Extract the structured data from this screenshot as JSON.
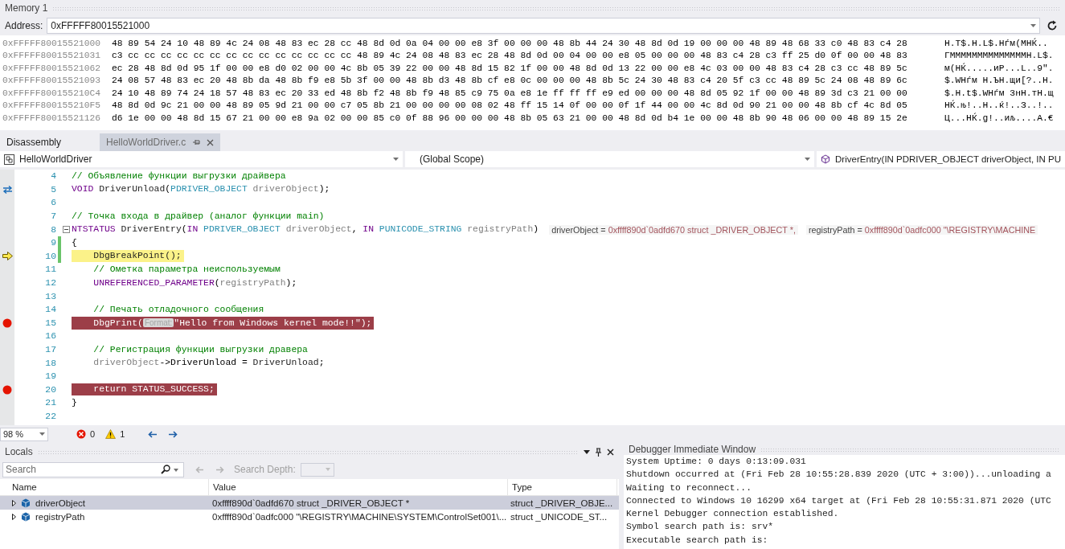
{
  "memory": {
    "title": "Memory 1",
    "address_label": "Address:",
    "address": "0xFFFFF80015521000",
    "rows": [
      {
        "address": "0xFFFFF80015521000",
        "bytes": "48 89 54 24 10 48 89 4c 24 08 48 83 ec 28 cc 48 8d 0d 0a 04 00 00 e8 3f 00 00 00 48 8b 44 24 30 48 8d 0d 19 00 00 00 48 89 48 68 33 c0 48 83 c4 28",
        "ascii": "H.T$.H.L$.Hѓм(МНЌ.."
      },
      {
        "address": "0xFFFFF80015521031",
        "bytes": "c3 cc cc cc cc cc cc cc cc cc cc cc cc cc cc 48 89 4c 24 08 48 83 ec 28 48 8d 0d 00 04 00 00 e8 05 00 00 00 48 83 c4 28 c3 ff 25 d0 0f 00 00 48 83",
        "ascii": "ГММММММММММММММH.L$."
      },
      {
        "address": "0xFFFFF80015521062",
        "bytes": "ec 28 48 8d 0d 95 1f 00 00 e8 d0 02 00 00 4c 8b 05 39 22 00 00 48 8d 15 82 1f 00 00 48 8d 0d 13 22 00 00 e8 4c 03 00 00 48 83 c4 28 c3 cc 48 89 5c",
        "ascii": "м(НЌ.....иР...L..9\"."
      },
      {
        "address": "0xFFFFF80015521093",
        "bytes": "24 08 57 48 83 ec 20 48 8b da 48 8b f9 e8 5b 3f 00 00 48 8b d3 48 8b cf e8 0c 00 00 00 48 8b 5c 24 30 48 83 c4 20 5f c3 cc 48 89 5c 24 08 48 89 6c",
        "ascii": "$.WHѓм Н.ЪН.щи[?..Н."
      },
      {
        "address": "0xFFFFF800155210C4",
        "bytes": "24 10 48 89 74 24 18 57 48 83 ec 20 33 ed 48 8b f2 48 8b f9 48 85 c9 75 0a e8 1e ff ff ff e9 ed 00 00 00 48 8d 05 92 1f 00 00 48 89 3d c3 21 00 00",
        "ascii": "$.H.t$.WHѓм 3нН.тН.щ"
      },
      {
        "address": "0xFFFFF800155210F5",
        "bytes": "48 8d 0d 9c 21 00 00 48 89 05 9d 21 00 00 c7 05 8b 21 00 00 00 00 08 02 48 ff 15 14 0f 00 00 0f 1f 44 00 00 4c 8d 0d 90 21 00 00 48 8b cf 4c 8d 05",
        "ascii": "НЌ.њ!..Н..ќ!..З..!.."
      },
      {
        "address": "0xFFFFF80015521126",
        "bytes": "d6 1e 00 00 48 8d 15 67 21 00 00 e8 9a 02 00 00 85 c0 0f 88 96 00 00 00 48 8b 05 63 21 00 00 48 8d 0d b4 1e 00 00 48 8b 90 48 06 00 00 48 89 15 2e",
        "ascii": "Ц...НЌ.g!..иљ....А.€"
      }
    ]
  },
  "editor": {
    "tabs": [
      {
        "label": "Disassembly",
        "selected": false
      },
      {
        "label": "HelloWorldDriver.c",
        "selected": true
      }
    ],
    "nav": {
      "project": "HelloWorldDriver",
      "scope": "(Global Scope)",
      "member": "DriverEntry(IN PDRIVER_OBJECT driverObject, IN PU"
    },
    "lines": [
      {
        "n": "4",
        "kind": "plain",
        "changed": false,
        "segments": [
          {
            "t": "// Объявление функции выгрузки драйвера",
            "kind": "comment"
          }
        ]
      },
      {
        "n": "5",
        "kind": "swap",
        "changed": false,
        "segments": [
          {
            "t": "VOID ",
            "kind": "macro"
          },
          {
            "t": "DriverUnload",
            "kind": "func"
          },
          {
            "t": "(",
            "kind": "plain"
          },
          {
            "t": "PDRIVER_OBJECT",
            "kind": "type"
          },
          {
            "t": " driverObject",
            "kind": "param"
          },
          {
            "t": ");",
            "kind": "plain"
          }
        ]
      },
      {
        "n": "6",
        "kind": "plain",
        "changed": false
      },
      {
        "n": "7",
        "kind": "plain",
        "changed": false,
        "segments": [
          {
            "t": "// Точка входа в драйвер (аналог функции main)",
            "kind": "comment"
          }
        ]
      },
      {
        "n": "8",
        "kind": "plain",
        "changed": false,
        "foldable": true,
        "segments": [
          {
            "t": "NTSTATUS ",
            "kind": "macro"
          },
          {
            "t": "DriverEntry",
            "kind": "func"
          },
          {
            "t": "(",
            "kind": "plain"
          },
          {
            "t": "IN ",
            "kind": "macro"
          },
          {
            "t": "PDRIVER_OBJECT",
            "kind": "type"
          },
          {
            "t": " driverObject",
            "kind": "param"
          },
          {
            "t": ", ",
            "kind": "plain"
          },
          {
            "t": "IN ",
            "kind": "macro"
          },
          {
            "t": "PUNICODE_STRING",
            "kind": "type"
          },
          {
            "t": " registryPath",
            "kind": "param"
          },
          {
            "t": ")",
            "kind": "plain"
          }
        ],
        "inline_values": [
          {
            "name": "driverObject = ",
            "value": "0xffff890d`0adfd670 struct _DRIVER_OBJECT *,"
          },
          {
            "name": "registryPath = ",
            "value": "0xffff890d`0adfc000 \"\\REGISTRY\\MACHINE"
          }
        ]
      },
      {
        "n": "9",
        "kind": "plain",
        "changed": true,
        "segments": [
          {
            "t": "{",
            "kind": "plain"
          }
        ]
      },
      {
        "n": "10",
        "kind": "current",
        "changed": true,
        "segments": [
          {
            "t": "    DbgBreakPoint();",
            "kind": "func"
          }
        ]
      },
      {
        "n": "11",
        "kind": "plain",
        "changed": false,
        "segments": [
          {
            "t": "    // Ометка параметра неиспользуемым",
            "kind": "comment"
          }
        ]
      },
      {
        "n": "12",
        "kind": "plain",
        "changed": false,
        "segments": [
          {
            "t": "    UNREFERENCED_PARAMETER",
            "kind": "macro"
          },
          {
            "t": "(",
            "kind": "plain"
          },
          {
            "t": "registryPath",
            "kind": "param"
          },
          {
            "t": ");",
            "kind": "plain"
          }
        ]
      },
      {
        "n": "13",
        "kind": "plain",
        "changed": false
      },
      {
        "n": "14",
        "kind": "plain",
        "changed": false,
        "segments": [
          {
            "t": "    // Печать отладочного сообщения",
            "kind": "comment"
          }
        ]
      },
      {
        "n": "15",
        "kind": "breakpoint",
        "changed": false,
        "segments": [
          {
            "t": "    DbgPrint(",
            "kind": "func"
          },
          {
            "t": "Format:",
            "kind": "hint"
          },
          {
            "t": "\"Hello from Windows kernel mode!!\"",
            "kind": "string"
          },
          {
            "t": ");",
            "kind": "plain"
          }
        ]
      },
      {
        "n": "16",
        "kind": "plain",
        "changed": false
      },
      {
        "n": "17",
        "kind": "plain",
        "changed": false,
        "segments": [
          {
            "t": "    // Регистрация функции выгрузки дравера",
            "kind": "comment"
          }
        ]
      },
      {
        "n": "18",
        "kind": "plain",
        "changed": false,
        "segments": [
          {
            "t": "    driverObject",
            "kind": "param"
          },
          {
            "t": "->DriverUnload = ",
            "kind": "plain"
          },
          {
            "t": "DriverUnload",
            "kind": "func"
          },
          {
            "t": ";",
            "kind": "plain"
          }
        ]
      },
      {
        "n": "19",
        "kind": "plain",
        "changed": false
      },
      {
        "n": "20",
        "kind": "breakpoint",
        "changed": false,
        "segments": [
          {
            "t": "    return ",
            "kind": "keyword"
          },
          {
            "t": "STATUS_SUCCESS",
            "kind": "macro"
          },
          {
            "t": ";",
            "kind": "plain"
          }
        ]
      },
      {
        "n": "21",
        "kind": "plain",
        "changed": false,
        "segments": [
          {
            "t": "}",
            "kind": "plain"
          }
        ]
      },
      {
        "n": "22",
        "kind": "plain",
        "changed": false
      }
    ],
    "status": {
      "zoom": "98 %",
      "errors": "0",
      "warnings": "1"
    }
  },
  "locals": {
    "title": "Locals",
    "search": {
      "placeholder": "Search"
    },
    "search_depth_label": "Search Depth:",
    "columns": [
      "Name",
      "Value",
      "Type"
    ],
    "rows": [
      {
        "name": "driverObject",
        "value": "0xffff890d`0adfd670 struct _DRIVER_OBJECT *",
        "type": "struct _DRIVER_OBJE...",
        "selected": true,
        "expanded": false
      },
      {
        "name": "registryPath",
        "value": "0xffff890d`0adfc000 \"\\REGISTRY\\MACHINE\\SYSTEM\\ControlSet001\\...",
        "type": "struct _UNICODE_ST...",
        "selected": false,
        "expanded": false
      }
    ]
  },
  "immediate": {
    "title": "Debugger Immediate Window",
    "lines": [
      "System Uptime: 0 days 0:13:09.031",
      "Shutdown occurred at (Fri Feb 28 10:55:28.839 2020 (UTC + 3:00))...unloading a",
      "Waiting to reconnect...",
      "Connected to Windows 10 16299 x64 target at (Fri Feb 28 10:55:31.871 2020 (UTC",
      "Kernel Debugger connection established.",
      "Symbol search path is: srv*",
      "Executable search path is:"
    ]
  }
}
